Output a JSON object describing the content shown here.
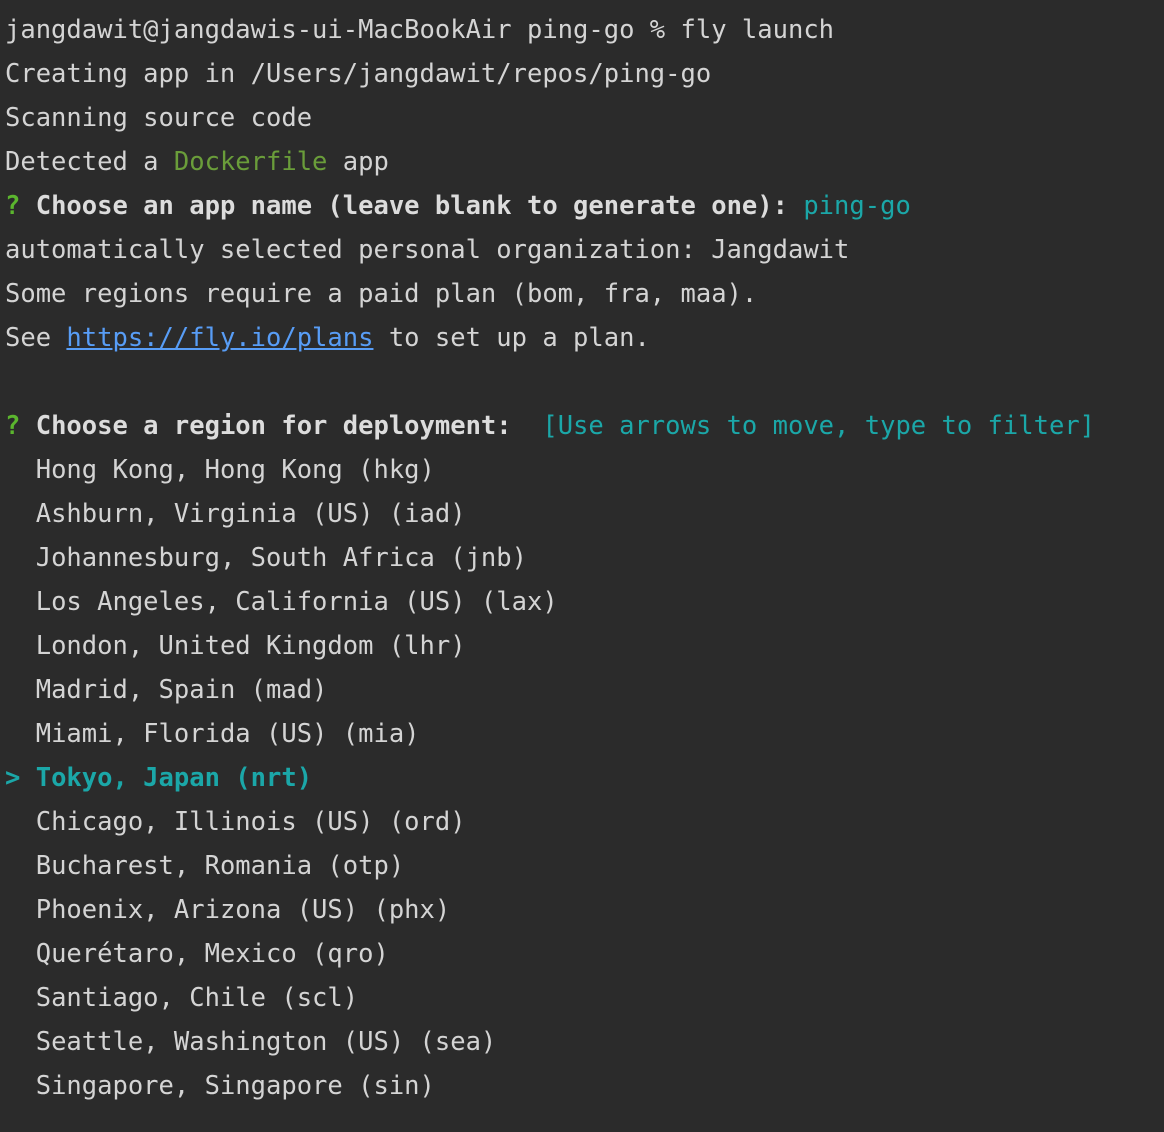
{
  "terminal": {
    "prompt": "jangdawit@jangdawis-ui-MacBookAir ping-go % fly launch",
    "lines": [
      "Creating app in /Users/jangdawit/repos/ping-go",
      "Scanning source code"
    ],
    "detected": {
      "prefix": "Detected a ",
      "keyword": "Dockerfile",
      "suffix": " app"
    },
    "app_name_question": {
      "mark": "?",
      "text": " Choose an app name (leave blank to generate one): ",
      "answer": "ping-go"
    },
    "org_line": "automatically selected personal organization: Jangdawit",
    "regions_note": "Some regions require a paid plan (bom, fra, maa).",
    "plans_line": {
      "prefix": "See ",
      "link": "https://fly.io/plans",
      "suffix": " to set up a plan."
    },
    "region_question": {
      "mark": "?",
      "text": " Choose a region for deployment:  ",
      "hint": "[Use arrows to move, type to filter]"
    },
    "cursor": ">",
    "regions": [
      "Hong Kong, Hong Kong (hkg)",
      "Ashburn, Virginia (US) (iad)",
      "Johannesburg, South Africa (jnb)",
      "Los Angeles, California (US) (lax)",
      "London, United Kingdom (lhr)",
      "Madrid, Spain (mad)",
      "Miami, Florida (US) (mia)",
      "Tokyo, Japan (nrt)",
      "Chicago, Illinois (US) (ord)",
      "Bucharest, Romania (otp)",
      "Phoenix, Arizona (US) (phx)",
      "Querétaro, Mexico (qro)",
      "Santiago, Chile (scl)",
      "Seattle, Washington (US) (sea)",
      "Singapore, Singapore (sin)"
    ],
    "selected_index": 7
  },
  "colors": {
    "background": "#2b2b2b",
    "text": "#d4d4d4",
    "accent_cyan": "#1ba7a8",
    "prompt_green": "#5bb52e",
    "keyword_green": "#6a9d3a",
    "link_blue": "#589df6"
  }
}
